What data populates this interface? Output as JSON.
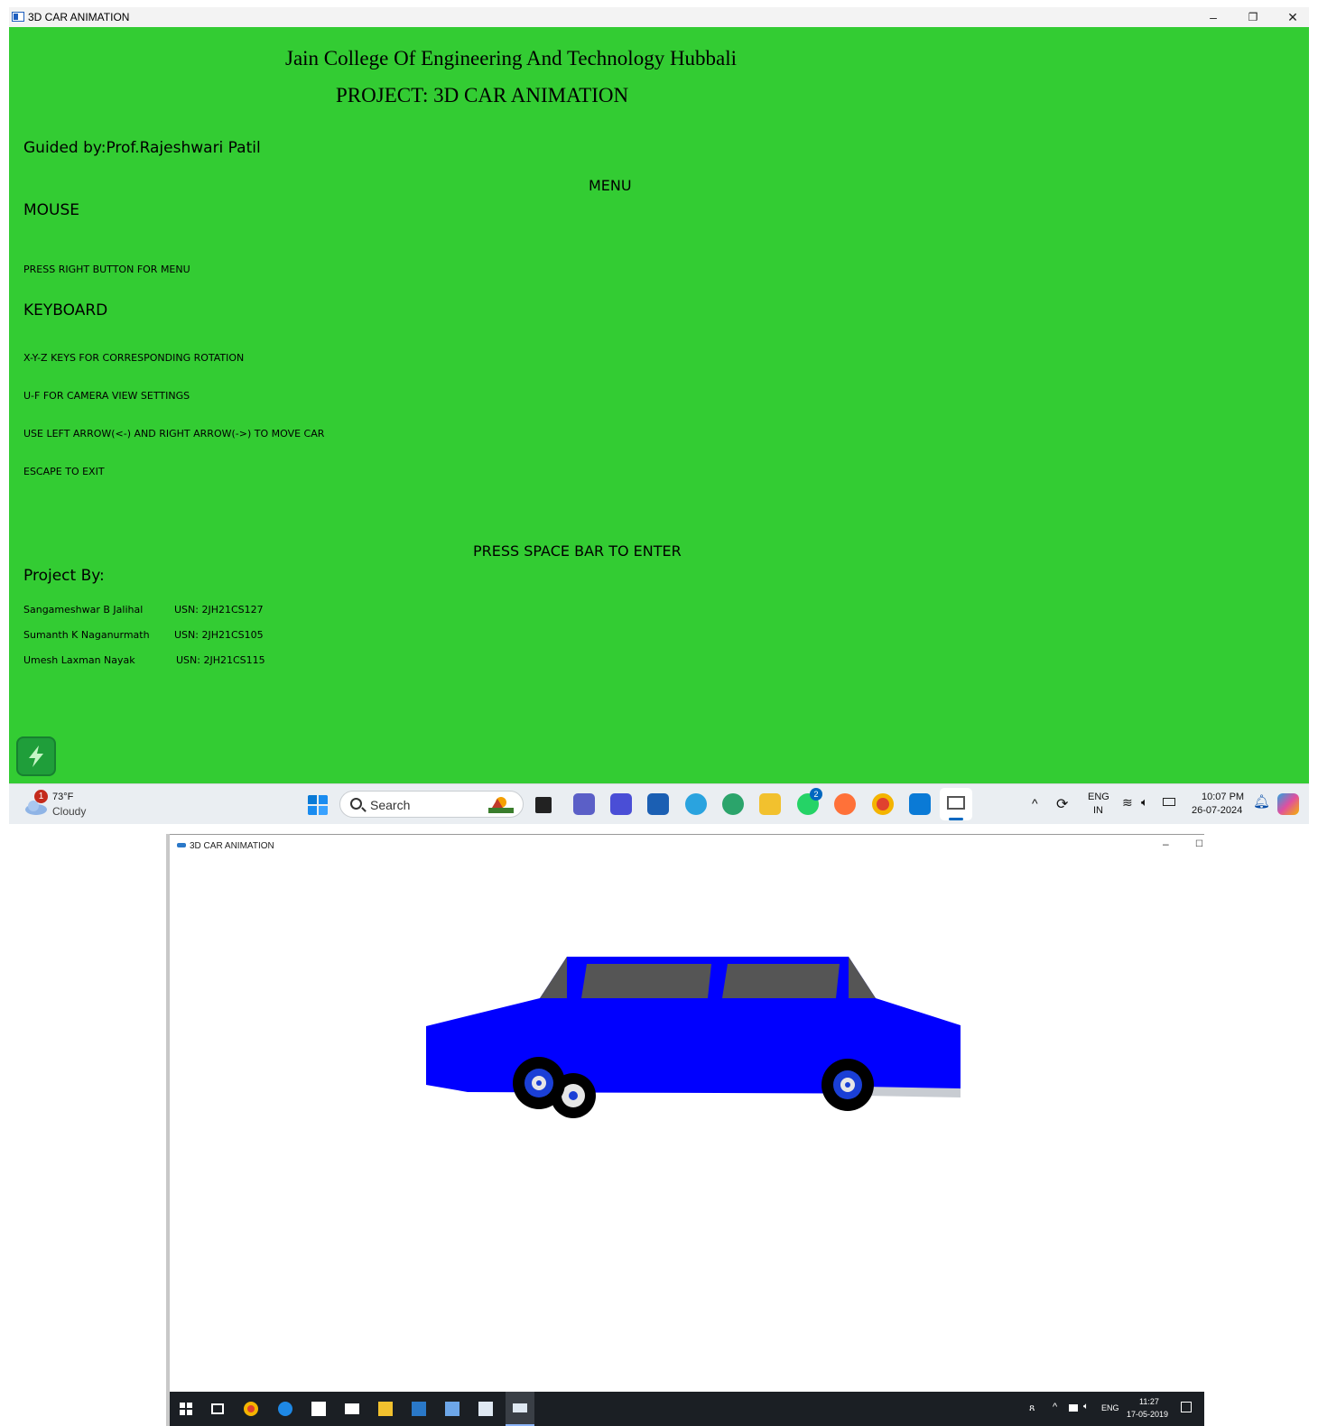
{
  "top_window": {
    "title": "3D CAR ANIMATION",
    "controls": {
      "minimize": "–",
      "restore": "❐",
      "close": "✕"
    },
    "content": {
      "college": "Jain College Of Engineering And Technology Hubbali",
      "project": "PROJECT:  3D CAR  ANIMATION",
      "guided_by": "Guided by:Prof.Rajeshwari Patil",
      "menu": "MENU",
      "mouse_heading": "MOUSE",
      "mouse_instr": "PRESS RIGHT BUTTON FOR MENU",
      "keyboard_heading": "KEYBOARD",
      "keys": [
        "X-Y-Z KEYS FOR CORRESPONDING ROTATION",
        "U-F FOR CAMERA VIEW SETTINGS",
        "USE LEFT ARROW(<-) AND RIGHT ARROW(->) TO MOVE CAR",
        "ESCAPE TO EXIT"
      ],
      "press_space": "PRESS SPACE BAR TO ENTER",
      "project_by": "Project By:",
      "members": [
        {
          "name": "Sangameshwar B Jalihal",
          "usn": "USN: 2JH21CS127"
        },
        {
          "name": "Sumanth K Naganurmath",
          "usn": "USN: 2JH21CS105"
        },
        {
          "name": "Umesh Laxman Nayak",
          "usn": "USN: 2JH21CS115"
        }
      ]
    },
    "taskbar": {
      "weather_temp": "73°F",
      "weather_desc": "Cloudy",
      "weather_badge": "1",
      "search_label": "Search",
      "whatsapp_badge": "2",
      "lang_top": "ENG",
      "lang_bottom": "IN",
      "time": "10:07 PM",
      "date": "26-07-2024",
      "colors": {
        "accent": "#0067c0",
        "bg": "#33cc33"
      }
    }
  },
  "bottom_window": {
    "title": "3D CAR ANIMATION",
    "controls": {
      "minimize": "–",
      "maximize": "☐"
    },
    "car_colors": {
      "body": "#0000ff",
      "window": "#555555",
      "tire": "#000000",
      "hub": "#1a3fd6"
    },
    "taskbar": {
      "lang": "ENG",
      "time": "11:27",
      "date": "17-05-2019"
    }
  }
}
